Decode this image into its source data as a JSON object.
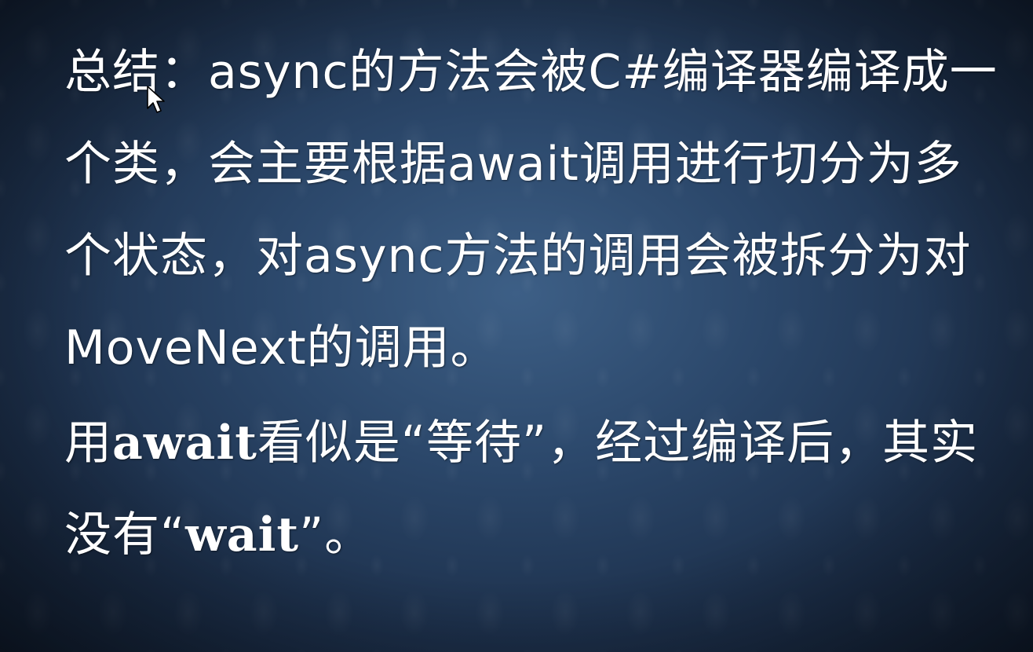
{
  "slide": {
    "paragraph1": "总结：async的方法会被C#编译器编译成一个类，会主要根据await调用进行切分为多个状态，对async方法的调用会被拆分为对MoveNext的调用。",
    "paragraph2": {
      "part1": "用",
      "part2": "await",
      "part3": "看似是“等待”，经过编译后，其实没有“",
      "part4": "wait",
      "part5": "”。"
    }
  },
  "colors": {
    "text": "#ffffff",
    "background_center": "#3d5f86",
    "background_edge": "#121f33"
  },
  "icons": {
    "cursor": "mouse-pointer-icon"
  }
}
